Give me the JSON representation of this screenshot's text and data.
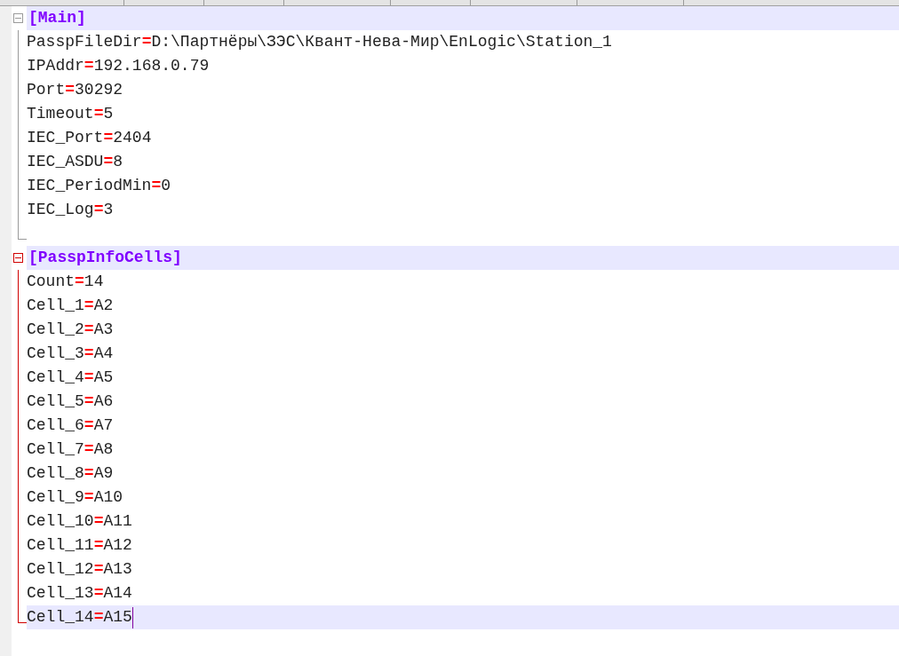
{
  "sections": [
    {
      "header": "[Main]",
      "active": false,
      "highlighted": true,
      "lines": [
        {
          "kind": "pair",
          "key": "PasspFileDir",
          "sep": "=",
          "value": "D:\\Партнёры\\ЗЭС\\Квант-Нева-Мир\\EnLogic\\Station_1",
          "highlighted": false,
          "caret": false
        },
        {
          "kind": "pair",
          "key": "IPAddr",
          "sep": "=",
          "value": "192.168.0.79",
          "highlighted": false,
          "caret": false
        },
        {
          "kind": "pair",
          "key": "Port",
          "sep": "=",
          "value": "30292",
          "highlighted": false,
          "caret": false
        },
        {
          "kind": "pair",
          "key": "Timeout",
          "sep": "=",
          "value": "5",
          "highlighted": false,
          "caret": false
        },
        {
          "kind": "pair",
          "key": "IEC_Port",
          "sep": "=",
          "value": "2404",
          "highlighted": false,
          "caret": false
        },
        {
          "kind": "pair",
          "key": "IEC_ASDU",
          "sep": "=",
          "value": "8",
          "highlighted": false,
          "caret": false
        },
        {
          "kind": "pair",
          "key": "IEC_PeriodMin",
          "sep": "=",
          "value": "0",
          "highlighted": false,
          "caret": false
        },
        {
          "kind": "pair",
          "key": "IEC_Log",
          "sep": "=",
          "value": "3",
          "highlighted": false,
          "caret": false
        },
        {
          "kind": "blank"
        }
      ]
    },
    {
      "header": "[PasspInfoCells]",
      "active": true,
      "highlighted": true,
      "lines": [
        {
          "kind": "pair",
          "key": "Count",
          "sep": "=",
          "value": "14",
          "highlighted": false,
          "caret": false
        },
        {
          "kind": "pair",
          "key": "Cell_1",
          "sep": "=",
          "value": "A2",
          "highlighted": false,
          "caret": false
        },
        {
          "kind": "pair",
          "key": "Cell_2",
          "sep": "=",
          "value": "A3",
          "highlighted": false,
          "caret": false
        },
        {
          "kind": "pair",
          "key": "Cell_3",
          "sep": "=",
          "value": "A4",
          "highlighted": false,
          "caret": false
        },
        {
          "kind": "pair",
          "key": "Cell_4",
          "sep": "=",
          "value": "A5",
          "highlighted": false,
          "caret": false
        },
        {
          "kind": "pair",
          "key": "Cell_5",
          "sep": "=",
          "value": "A6",
          "highlighted": false,
          "caret": false
        },
        {
          "kind": "pair",
          "key": "Cell_6",
          "sep": "=",
          "value": "A7",
          "highlighted": false,
          "caret": false
        },
        {
          "kind": "pair",
          "key": "Cell_7",
          "sep": "=",
          "value": "A8",
          "highlighted": false,
          "caret": false
        },
        {
          "kind": "pair",
          "key": "Cell_8",
          "sep": "=",
          "value": "A9",
          "highlighted": false,
          "caret": false
        },
        {
          "kind": "pair",
          "key": "Cell_9",
          "sep": "=",
          "value": "A10",
          "highlighted": false,
          "caret": false
        },
        {
          "kind": "pair",
          "key": "Cell_10",
          "sep": "=",
          "value": "A11",
          "highlighted": false,
          "caret": false
        },
        {
          "kind": "pair",
          "key": "Cell_11",
          "sep": "=",
          "value": "A12",
          "highlighted": false,
          "caret": false
        },
        {
          "kind": "pair",
          "key": "Cell_12",
          "sep": "=",
          "value": "A13",
          "highlighted": false,
          "caret": false
        },
        {
          "kind": "pair",
          "key": "Cell_13",
          "sep": "=",
          "value": "A14",
          "highlighted": false,
          "caret": false
        },
        {
          "kind": "pair",
          "key": "Cell_14",
          "sep": "=",
          "value": "A15",
          "highlighted": true,
          "caret": true
        }
      ]
    }
  ]
}
